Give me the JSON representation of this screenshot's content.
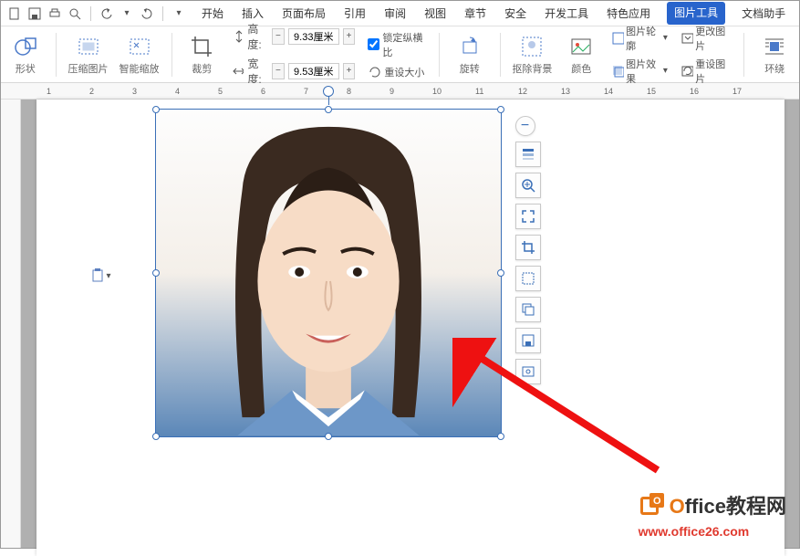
{
  "qat": [
    "new-icon",
    "save-icon",
    "print-icon",
    "preview-icon",
    "undo-icon",
    "redo-icon"
  ],
  "tabs": {
    "items": [
      "开始",
      "插入",
      "页面布局",
      "引用",
      "审阅",
      "视图",
      "章节",
      "安全",
      "开发工具",
      "特色应用"
    ],
    "active": "图片工具",
    "helper": "文档助手"
  },
  "ribbon": {
    "shape": "形状",
    "compress": "压缩图片",
    "smartzoom": "智能缩放",
    "crop": "裁剪",
    "height_label": "高度:",
    "width_label": "宽度:",
    "height_val": "9.33厘米",
    "width_val": "9.53厘米",
    "lock_ratio": "锁定纵横比",
    "reset_size": "重设大小",
    "rotate": "旋转",
    "remove_bg": "抠除背景",
    "color": "颜色",
    "outline": "图片轮廓",
    "effect": "图片效果",
    "change": "更改图片",
    "reset_pic": "重设图片",
    "wrap": "环绕"
  },
  "ruler_ticks": [
    "1",
    "2",
    "3",
    "4",
    "5",
    "6",
    "7",
    "8",
    "9",
    "10",
    "11",
    "12",
    "13",
    "14",
    "15",
    "16",
    "17"
  ],
  "watermark": {
    "brand1_a": "O",
    "brand1_b": "ffice",
    "brand1_c": "教程网",
    "url": "www.office26.com"
  }
}
